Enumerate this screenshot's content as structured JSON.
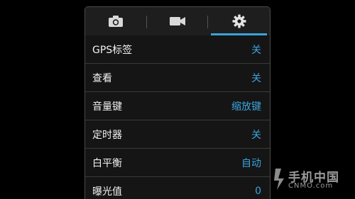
{
  "tabs": [
    {
      "label": "camera",
      "icon": "camera-icon",
      "selected": false
    },
    {
      "label": "video",
      "icon": "video-camera-icon",
      "selected": false
    },
    {
      "label": "settings",
      "icon": "gear-icon",
      "selected": true
    }
  ],
  "settings": [
    {
      "label": "GPS标签",
      "value": "关"
    },
    {
      "label": "查看",
      "value": "关"
    },
    {
      "label": "音量键",
      "value": "缩放键"
    },
    {
      "label": "定时器",
      "value": "关"
    },
    {
      "label": "白平衡",
      "value": "自动"
    },
    {
      "label": "曝光值",
      "value": "0"
    }
  ],
  "watermark": {
    "title": "手机中国",
    "subtitle": "CNMO.com"
  },
  "colors": {
    "accent": "#3aa3dc",
    "value_text": "#3ba4de",
    "panel_bg": "#151515",
    "tabbar_bg": "#1e1e1e",
    "divider": "#3a3a3a"
  }
}
